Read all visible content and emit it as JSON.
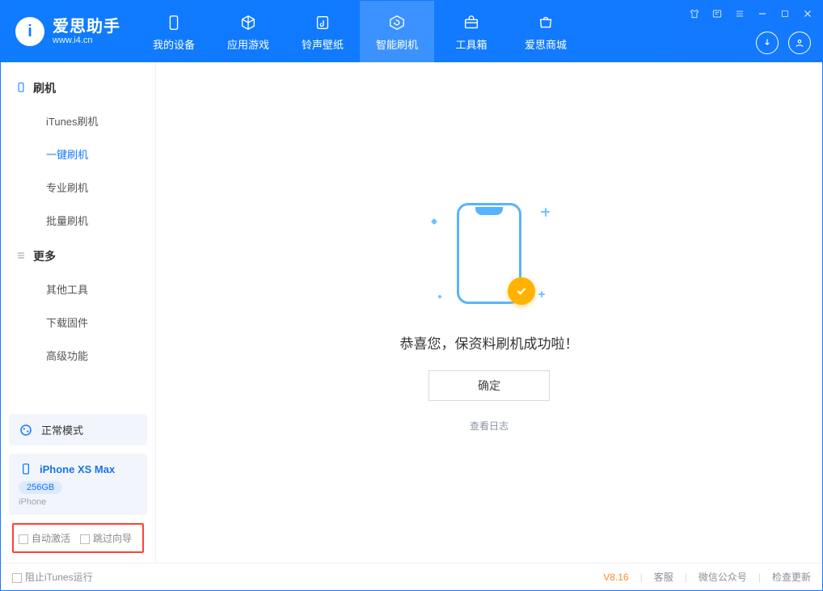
{
  "app": {
    "name_cn": "爱思助手",
    "site": "www.i4.cn"
  },
  "header_tabs": [
    {
      "label": "我的设备",
      "icon": "device-icon"
    },
    {
      "label": "应用游戏",
      "icon": "cube-icon"
    },
    {
      "label": "铃声壁纸",
      "icon": "music-icon"
    },
    {
      "label": "智能刷机",
      "icon": "refresh-icon",
      "active": true
    },
    {
      "label": "工具箱",
      "icon": "toolbox-icon"
    },
    {
      "label": "爱思商城",
      "icon": "store-icon"
    }
  ],
  "sidebar": {
    "group1": {
      "title": "刷机",
      "items": [
        "iTunes刷机",
        "一键刷机",
        "专业刷机",
        "批量刷机"
      ],
      "active_index": 1
    },
    "group2": {
      "title": "更多",
      "items": [
        "其他工具",
        "下载固件",
        "高级功能"
      ]
    },
    "mode_label": "正常模式",
    "device": {
      "name": "iPhone XS Max",
      "capacity": "256GB",
      "type": "iPhone"
    },
    "checkbox1": "自动激活",
    "checkbox2": "跳过向导"
  },
  "main": {
    "success_text": "恭喜您，保资料刷机成功啦！",
    "ok_button": "确定",
    "view_log": "查看日志"
  },
  "footer": {
    "block_itunes": "阻止iTunes运行",
    "version": "V8.16",
    "links": [
      "客服",
      "微信公众号",
      "检查更新"
    ]
  }
}
